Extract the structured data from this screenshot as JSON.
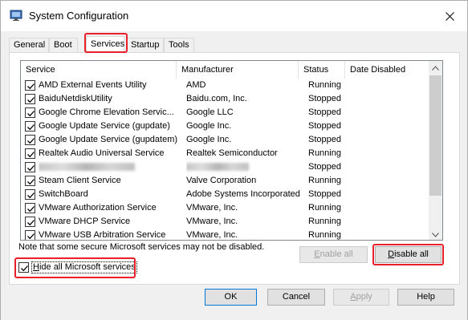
{
  "window": {
    "title": "System Configuration",
    "icon": "msconfig-icon"
  },
  "tabs": [
    {
      "label": "General",
      "active": false
    },
    {
      "label": "Boot",
      "active": false
    },
    {
      "label": "Services",
      "active": true
    },
    {
      "label": "Startup",
      "active": false
    },
    {
      "label": "Tools",
      "active": false
    }
  ],
  "services": {
    "columns": [
      "Service",
      "Manufacturer",
      "Status",
      "Date Disabled"
    ],
    "rows": [
      {
        "name": "AMD External Events Utility",
        "manufacturer": "AMD",
        "status": "Running",
        "checked": true
      },
      {
        "name": "BaiduNetdiskUtility",
        "manufacturer": "Baidu.com, Inc.",
        "status": "Stopped",
        "checked": true
      },
      {
        "name": "Google Chrome Elevation Servic...",
        "manufacturer": "Google LLC",
        "status": "Stopped",
        "checked": true
      },
      {
        "name": "Google Update Service (gupdate)",
        "manufacturer": "Google Inc.",
        "status": "Stopped",
        "checked": true
      },
      {
        "name": "Google Update Service (gupdatem)",
        "manufacturer": "Google Inc.",
        "status": "Stopped",
        "checked": true
      },
      {
        "name": "Realtek Audio Universal Service",
        "manufacturer": "Realtek Semiconductor",
        "status": "Running",
        "checked": true
      },
      {
        "name": "",
        "manufacturer": "",
        "status": "Stopped",
        "checked": true,
        "redacted": true
      },
      {
        "name": "Steam Client Service",
        "manufacturer": "Valve Corporation",
        "status": "Running",
        "checked": true
      },
      {
        "name": "SwitchBoard",
        "manufacturer": "Adobe Systems Incorporated",
        "status": "Stopped",
        "checked": true
      },
      {
        "name": "VMware Authorization Service",
        "manufacturer": "VMware, Inc.",
        "status": "Running",
        "checked": true
      },
      {
        "name": "VMware DHCP Service",
        "manufacturer": "VMware, Inc.",
        "status": "Running",
        "checked": true
      },
      {
        "name": "VMware USB Arbitration Service",
        "manufacturer": "VMware, Inc.",
        "status": "Running",
        "checked": true
      }
    ]
  },
  "note": "Note that some secure Microsoft services may not be disabled.",
  "buttons": {
    "enable_all": "Enable all",
    "disable_all": "Disable all",
    "ok": "OK",
    "cancel": "Cancel",
    "apply": "Apply",
    "help": "Help"
  },
  "hide_microsoft": {
    "label": "Hide all Microsoft services",
    "checked": true
  },
  "colors": {
    "highlight": "#e8202a",
    "border": "#828790"
  }
}
